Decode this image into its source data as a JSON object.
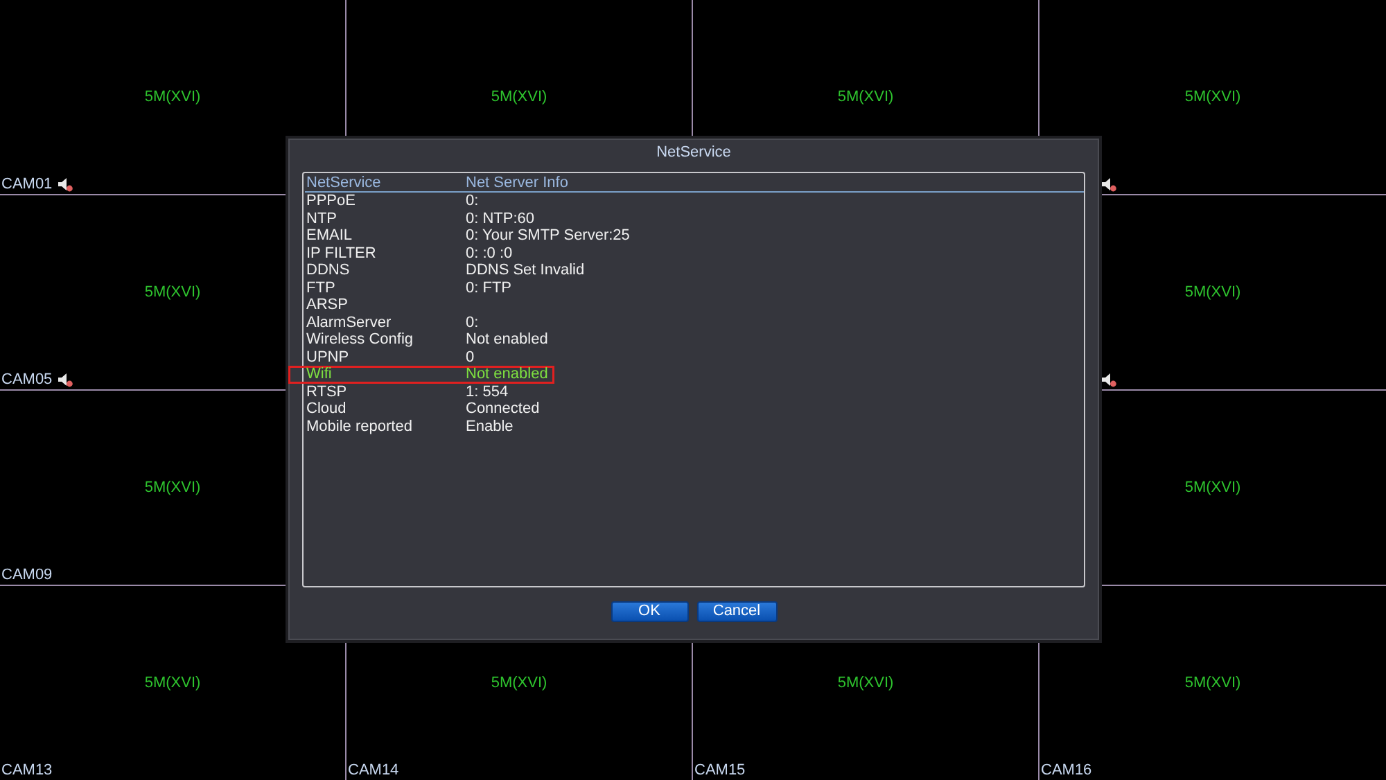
{
  "camera_rows": [
    [
      {
        "label": "CAM01",
        "format": "5M(XVI)",
        "audio": true
      },
      {
        "format": "5M(XVI)",
        "audio": false
      },
      {
        "format": "5M(XVI)",
        "audio": false
      },
      {
        "format": "5M(XVI)",
        "audio": true
      }
    ],
    [
      {
        "label": "CAM05",
        "format": "5M(XVI)",
        "audio": true
      },
      {
        "format": "5M(XVI)",
        "audio": true
      }
    ],
    [
      {
        "label": "CAM09",
        "format": "5M(XVI)",
        "audio": false
      },
      {
        "format": "5M(XVI)",
        "audio": false
      }
    ],
    [
      {
        "label": "CAM13",
        "format": "5M(XVI)",
        "audio": false
      },
      {
        "label": "CAM14",
        "format": "5M(XVI)",
        "audio": false
      },
      {
        "label": "CAM15",
        "format": "5M(XVI)",
        "audio": false
      },
      {
        "label": "CAM16",
        "format": "5M(XVI)",
        "audio": false
      }
    ]
  ],
  "dialog": {
    "title": "NetService",
    "columns": [
      "NetService",
      "Net Server Info"
    ],
    "rows": [
      {
        "name": "PPPoE",
        "info": "0:",
        "selected": false
      },
      {
        "name": "NTP",
        "info": "0: NTP:60",
        "selected": false
      },
      {
        "name": "EMAIL",
        "info": "0: Your SMTP Server:25",
        "selected": false
      },
      {
        "name": "IP FILTER",
        "info": "0: :0 :0",
        "selected": false
      },
      {
        "name": "DDNS",
        "info": "DDNS Set Invalid",
        "selected": false
      },
      {
        "name": "FTP",
        "info": "0: FTP",
        "selected": false
      },
      {
        "name": "ARSP",
        "selected": false
      },
      {
        "name": "AlarmServer",
        "info": "0:",
        "selected": false
      },
      {
        "name": "Wireless Config",
        "info": "Not enabled",
        "selected": false
      },
      {
        "name": "UPNP",
        "info": "0",
        "selected": false
      },
      {
        "name": "Wifi",
        "info": "Not enabled",
        "selected": true
      },
      {
        "name": "RTSP",
        "info": "1: 554",
        "selected": false
      },
      {
        "name": "Cloud",
        "info": "Connected",
        "selected": false
      },
      {
        "name": "Mobile reported",
        "info": "Enable",
        "selected": false
      }
    ],
    "buttons": [
      "OK",
      "Cancel"
    ]
  }
}
